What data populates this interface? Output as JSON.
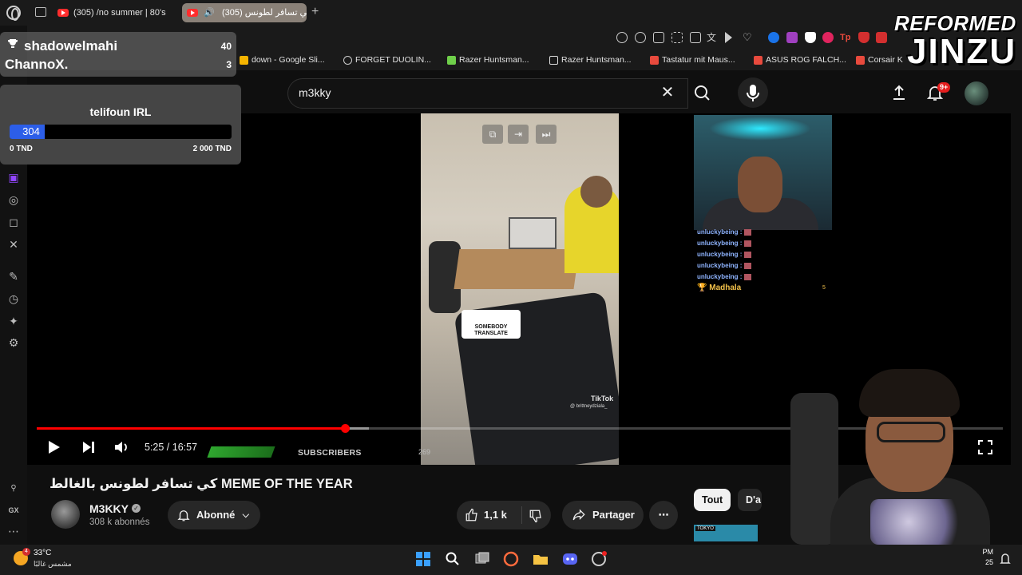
{
  "browser": {
    "tabs": [
      {
        "title": "(305) /no summer | 80's"
      },
      {
        "title": "كي تسافر لطونس (305)"
      }
    ],
    "bookmarks": [
      {
        "label": "down - Google Sli...",
        "color": "#f5b400"
      },
      {
        "label": "FORGET DUOLIN...",
        "color": "#cccccc"
      },
      {
        "label": "Razer Huntsman...",
        "color": "#6fcf4a"
      },
      {
        "label": "Razer Huntsman...",
        "color": "#dddddd"
      },
      {
        "label": "Tastatur mit Maus...",
        "color": "#e84a3d"
      },
      {
        "label": "ASUS ROG FALCH...",
        "color": "#e84a3d"
      },
      {
        "label": "Corsair K",
        "color": "#e84a3d"
      }
    ]
  },
  "youtube": {
    "search_query": "m3kky",
    "notifications_count": "9+"
  },
  "overlay": {
    "top_chatters": [
      {
        "name": "shadowelmahi",
        "count": "40"
      },
      {
        "name": "ChannoX.",
        "count": "3"
      }
    ],
    "donation_goal": {
      "title": "telifoun IRL",
      "current": "304",
      "progress_fraction": 0.152,
      "min_label": "0 TND",
      "max_label": "2 000 TND"
    },
    "chat_lines": [
      "unluckybeing :",
      "unluckybeing :",
      "unluckybeing :",
      "unluckybeing :",
      "unluckybeing :"
    ],
    "chat_top_user": "Madhala",
    "chat_top_num": "5",
    "subs_widget": {
      "label": "SUBSCRIBERS",
      "goal": "269"
    },
    "brand_line1": "REFORMED",
    "brand_line2": "JINZU"
  },
  "video": {
    "time_display": "5:25 / 16:57",
    "progress_fraction": 0.319,
    "buffered_fraction": 0.344,
    "sticker_text": "SOMEBODY TRANSLATE",
    "tiktok_label": "TikTok",
    "tiktok_handle": "@ brittneydziala_",
    "title": "كي تسافر لطونس بالغالط MEME OF THE YEAR",
    "channel": {
      "name": "M3KKY",
      "subscribers": "308 k abonnés"
    },
    "subscribe_label": "Abonné",
    "likes": "1,1 k",
    "share_label": "Partager"
  },
  "recommendations": {
    "chips": [
      "Tout",
      "D'a"
    ],
    "thumb_label": "TOKYO"
  },
  "taskbar": {
    "temperature": "33°C",
    "weather_desc": "مشمس غالبًا",
    "weather_badge": "4",
    "clock_line1": "PM",
    "clock_line2": "25"
  }
}
